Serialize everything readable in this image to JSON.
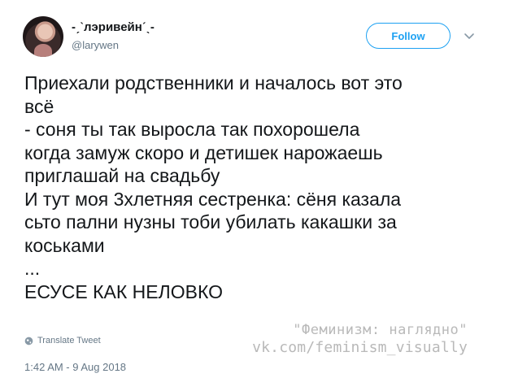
{
  "author": {
    "display_name": "-ˏˋлэривейнˊˎ-",
    "handle": "@larywen"
  },
  "actions": {
    "follow_label": "Follow"
  },
  "tweet": {
    "lines": [
      "Приехали родственники и началось вот это",
      "всё",
      "- соня ты так выросла так похорошела",
      "когда замуж скоро и детишек нарожаешь",
      "приглашай на свадьбу",
      "И тут моя 3хлетняя сестренка: сёня казала",
      "сьто пални нузны тоби убилать какашки за",
      "коськами",
      "...",
      "ЕСУСЕ КАК НЕЛОВКО"
    ],
    "translate_label": "Translate Tweet",
    "timestamp": "1:42 AM - 9 Aug 2018"
  },
  "watermark": {
    "line1": "\"Феминизм: наглядно\"",
    "line2": "vk.com/feminism_visually"
  },
  "colors": {
    "brand_blue": "#1da1f2",
    "muted_gray": "#657786",
    "text_dark": "#14171a",
    "watermark_gray": "#b9b9b9"
  },
  "icons": {
    "avatar": "user-avatar",
    "chevron": "chevron-down-icon",
    "translate": "globe-icon"
  }
}
